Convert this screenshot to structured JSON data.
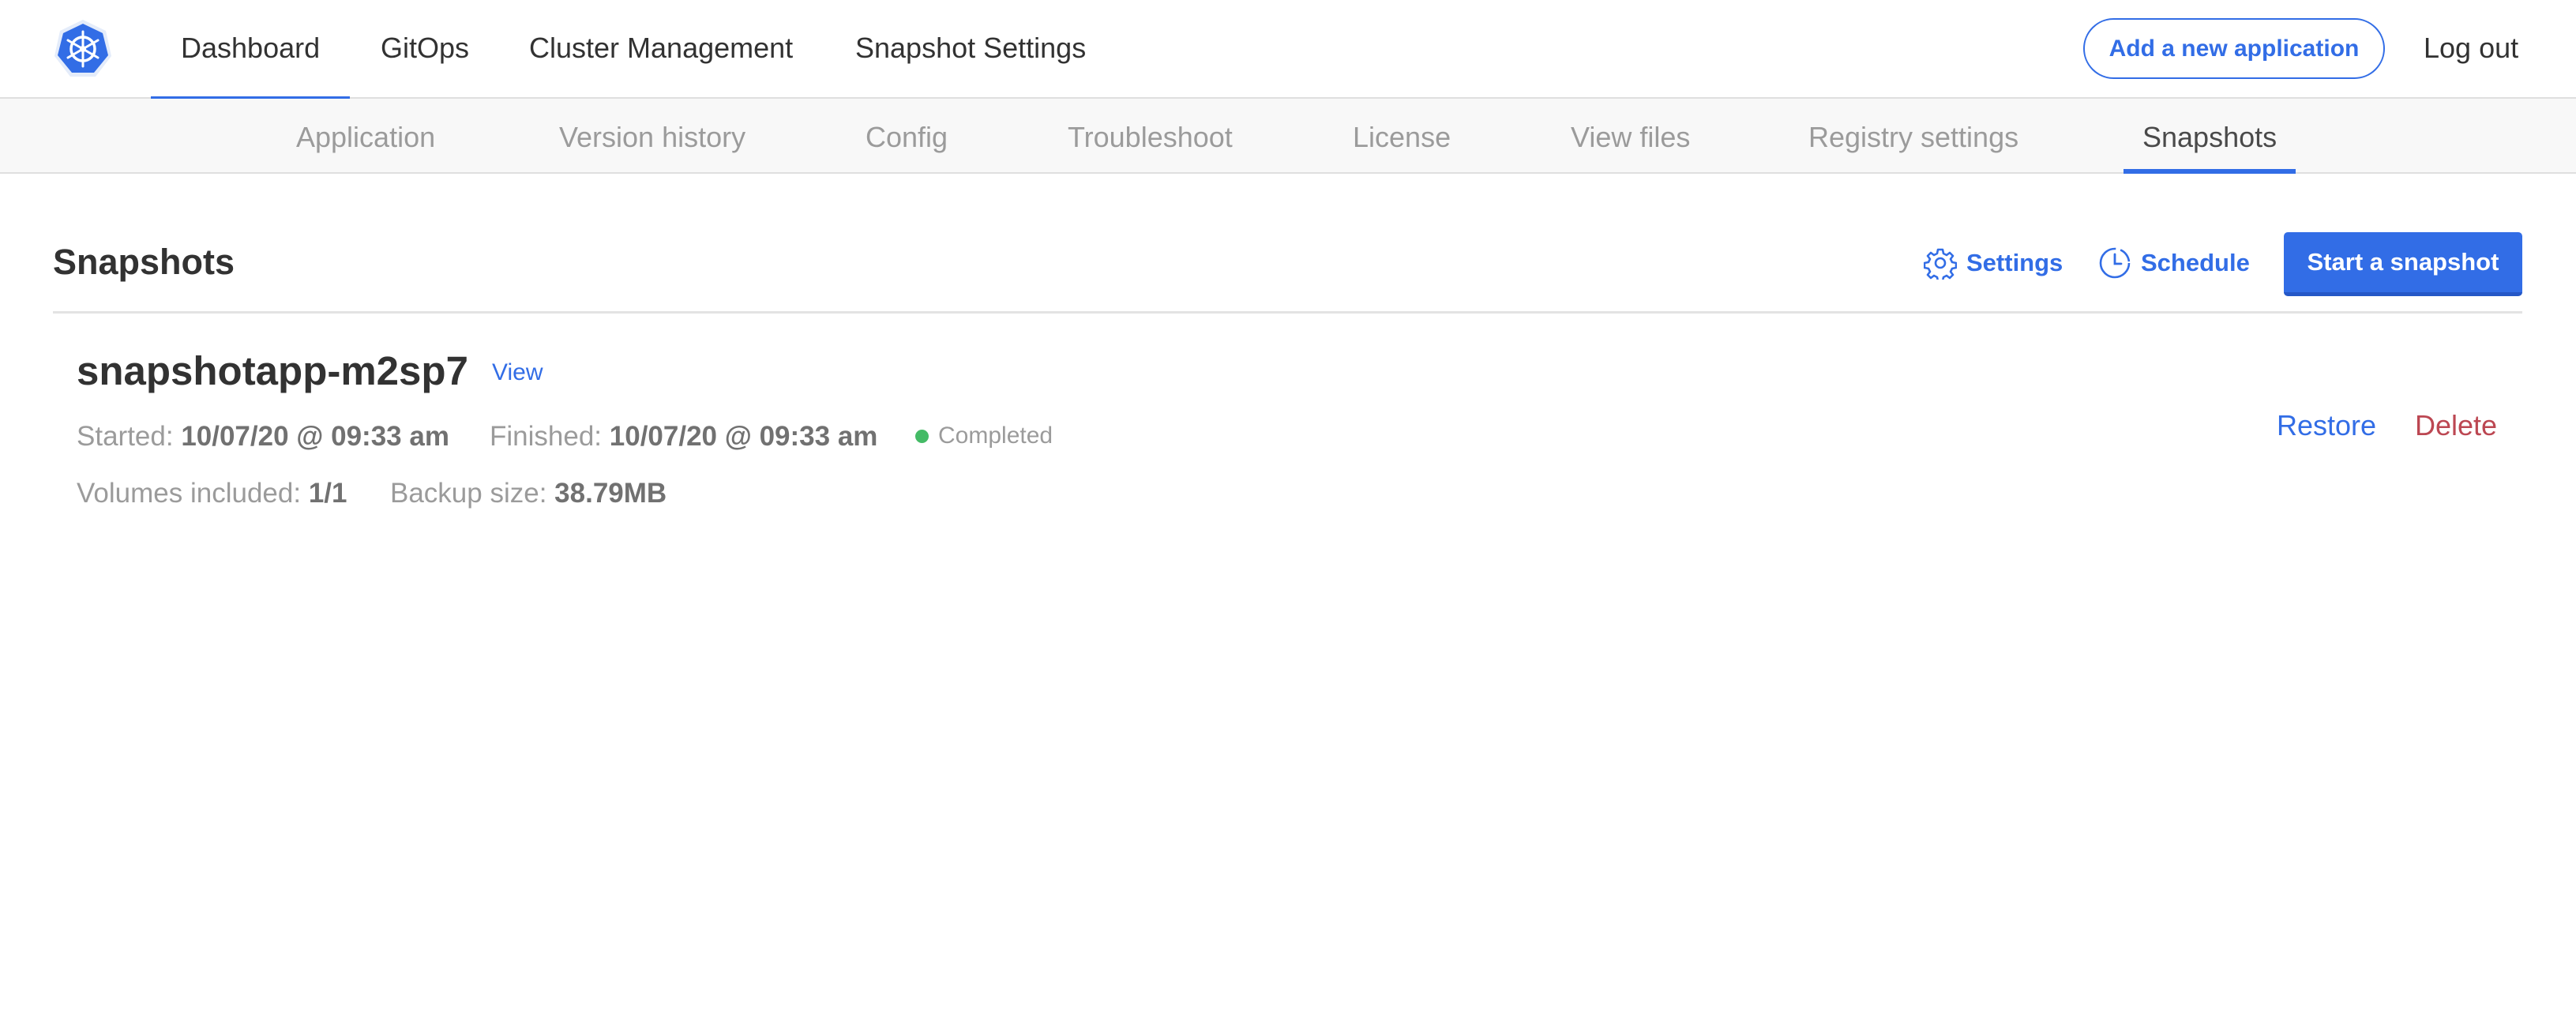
{
  "nav": {
    "logo_icon": "kubernetes-helm-icon",
    "items": [
      {
        "label": "Dashboard",
        "active": true
      },
      {
        "label": "GitOps",
        "active": false
      },
      {
        "label": "Cluster Management",
        "active": false
      },
      {
        "label": "Snapshot Settings",
        "active": false
      }
    ],
    "add_app_label": "Add a new application",
    "logout_label": "Log out"
  },
  "subnav": {
    "items": [
      {
        "label": "Application"
      },
      {
        "label": "Version history"
      },
      {
        "label": "Config"
      },
      {
        "label": "Troubleshoot"
      },
      {
        "label": "License"
      },
      {
        "label": "View files"
      },
      {
        "label": "Registry settings"
      },
      {
        "label": "Snapshots",
        "active": true
      }
    ]
  },
  "page": {
    "title": "Snapshots",
    "settings_label": "Settings",
    "settings_icon": "gear-icon",
    "schedule_label": "Schedule",
    "schedule_icon": "clock-icon",
    "start_label": "Start a snapshot"
  },
  "snapshot": {
    "name": "snapshotapp-m2sp7",
    "view_label": "View",
    "started_label": "Started:",
    "started_value": "10/07/20 @ 09:33 am",
    "finished_label": "Finished:",
    "finished_value": "10/07/20 @ 09:33 am",
    "status": "Completed",
    "volumes_label": "Volumes included:",
    "volumes_value": "1/1",
    "size_label": "Backup size:",
    "size_value": "38.79MB",
    "restore_label": "Restore",
    "delete_label": "Delete"
  },
  "colors": {
    "accent": "#326de6",
    "delete": "#bc4752",
    "status_ok": "#44bb66"
  }
}
